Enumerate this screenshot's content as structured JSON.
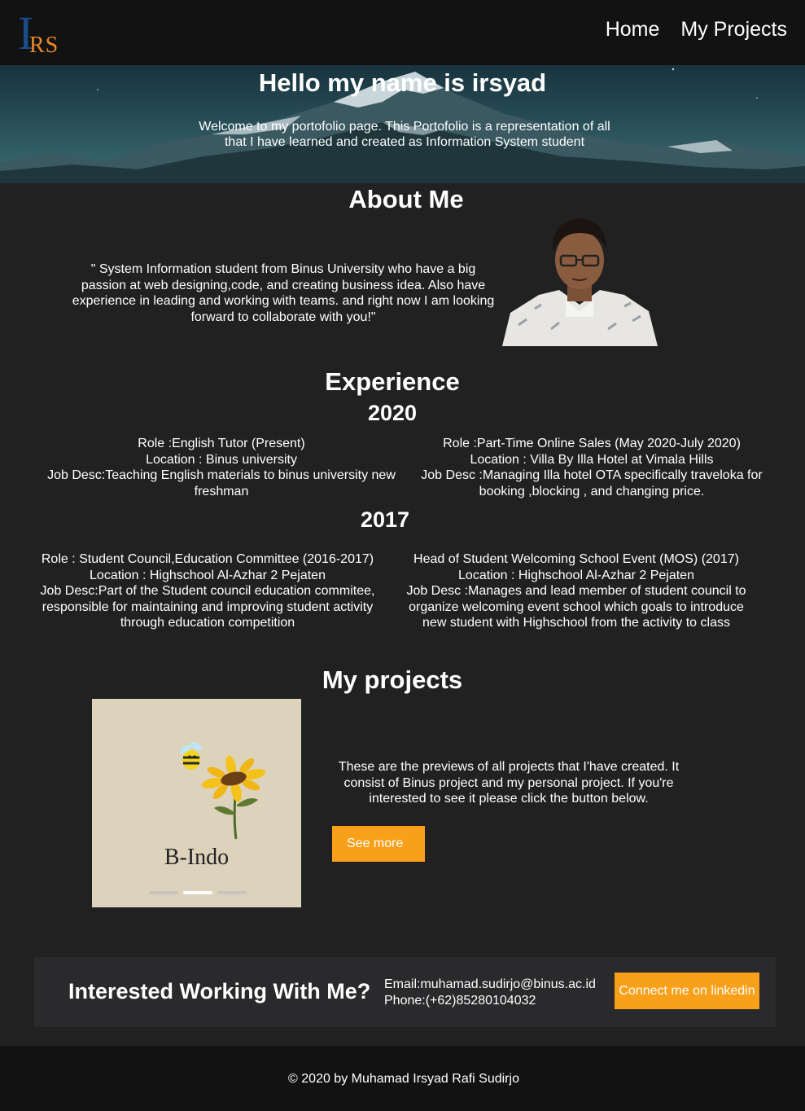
{
  "nav": {
    "logo_letter_i": "I",
    "logo_letters_rs": "RS",
    "links": [
      "Home",
      "My Projects"
    ]
  },
  "hero": {
    "title": "Hello my name is irsyad",
    "subtitle": "Welcome to my portofolio page. This Portofolio is a representation of all that I have learned and created as Information System student"
  },
  "about": {
    "heading": "About Me",
    "text": "\" System Information student from Binus University who have a big passion at web designing,code, and creating business idea. Also have experience in leading and working with teams. and right now I am looking forward to collaborate with you!\""
  },
  "experience": {
    "heading": "Experience",
    "years": [
      {
        "year": "2020",
        "entries": [
          {
            "role": "Role :English Tutor (Present)",
            "location": "Location : Binus university",
            "desc": "Job Desc:Teaching English materials to binus university new freshman"
          },
          {
            "role": "Role :Part-Time Online Sales (May 2020-July 2020)",
            "location": "Location : Villa By Illa Hotel at Vimala Hills",
            "desc": "Job Desc :Managing Illa hotel OTA specifically traveloka for booking ,blocking , and changing price."
          }
        ]
      },
      {
        "year": "2017",
        "entries": [
          {
            "role": "Role : Student Council,Education Committee  (2016-2017)",
            "location": "Location : Highschool Al-Azhar 2 Pejaten",
            "desc": "Job Desc:Part of the Student council education commitee, responsible for maintaining and improving student activity through education competition"
          },
          {
            "role": "Head of Student Welcoming School Event (MOS) (2017)",
            "location": "Location : Highschool Al-Azhar 2 Pejaten",
            "desc": "Job Desc :Manages and lead member of student council to organize welcoming event school which goals to introduce new student with Highschool from the activity to class"
          }
        ]
      }
    ]
  },
  "projects": {
    "heading": "My projects",
    "carousel_label": "B-Indo",
    "carousel_active_index": 1,
    "carousel_count": 3,
    "text": "These are the previews of all projects that I'have created. It consist of Binus project and my personal project. If you're interested to see it please click the button below.",
    "button": "See more"
  },
  "contact": {
    "heading": "Interested Working With Me?",
    "email": "Email:muhamad.sudirjo@binus.ac.id",
    "phone": "Phone:(+62)85280104032",
    "button": "Connect me on linkedin"
  },
  "footer": {
    "text": "© 2020 by Muhamad Irsyad Rafi Sudirjo"
  },
  "colors": {
    "accent": "#f9a01b",
    "background": "#212121",
    "nav_background": "#121212",
    "logo_blue": "#1a4c8a",
    "logo_orange": "#e8892b"
  }
}
